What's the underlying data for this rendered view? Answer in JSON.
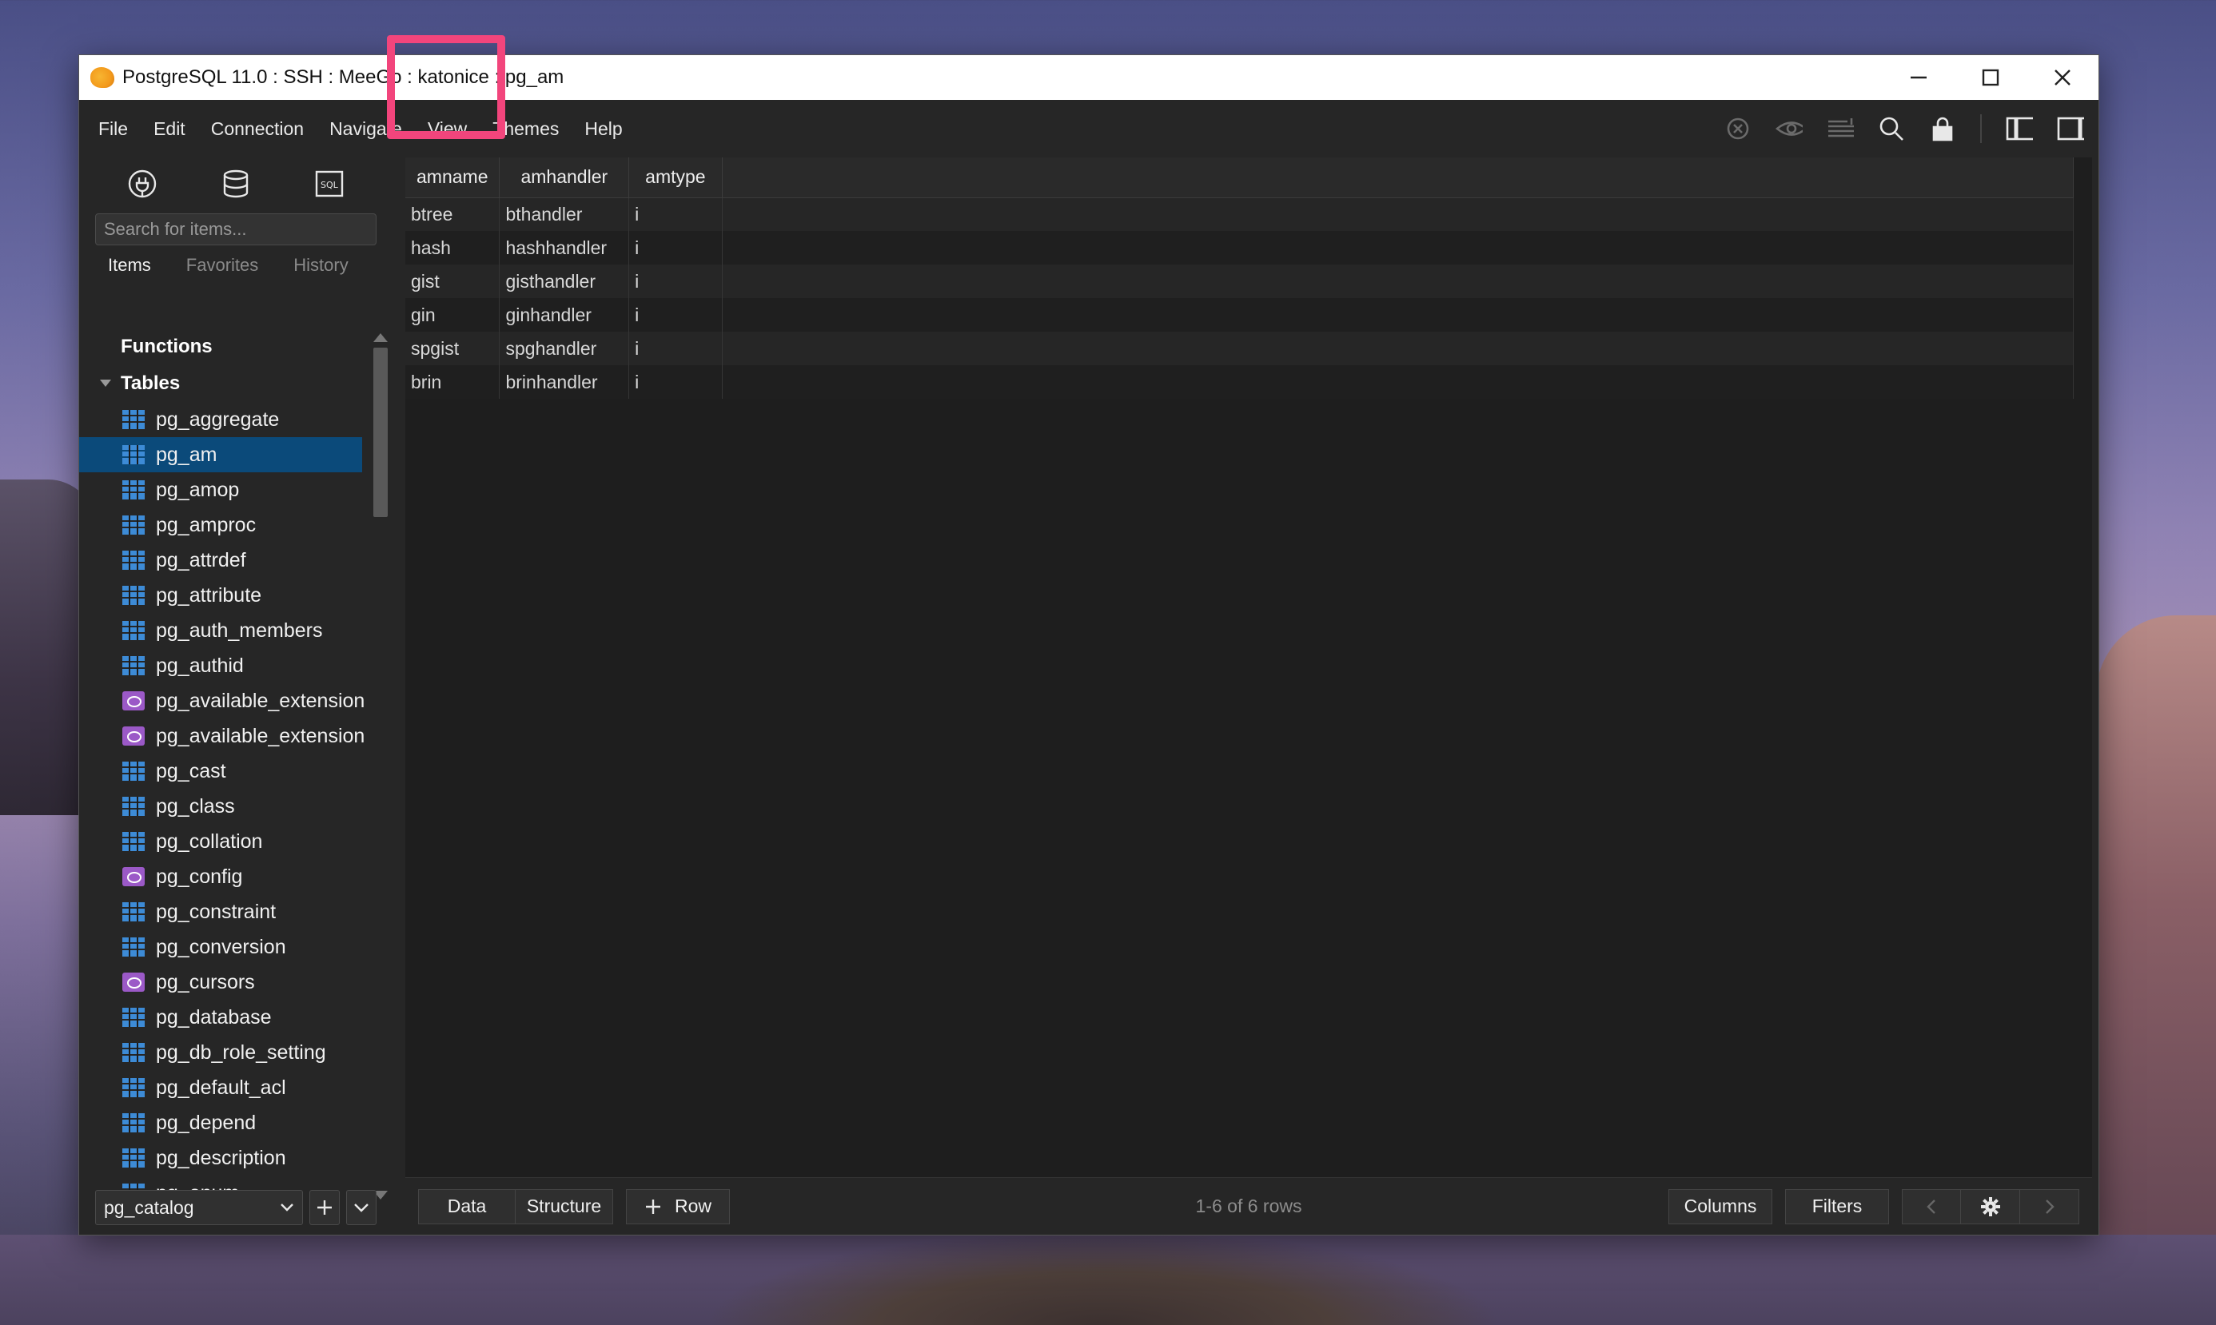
{
  "window": {
    "title": "PostgreSQL 11.0 : SSH : MeeGo : katonice : pg_am"
  },
  "menu": [
    "File",
    "Edit",
    "Connection",
    "Navigate",
    "View",
    "Themes",
    "Help"
  ],
  "toolbar_icons": [
    "close-circle-icon",
    "eye-icon",
    "lines-icon",
    "search-icon",
    "lock-icon",
    "left-panel-icon",
    "right-panel-icon"
  ],
  "sidebar": {
    "search_placeholder": "Search for items...",
    "tabs": [
      "Items",
      "Favorites",
      "History"
    ],
    "active_tab": "Items",
    "groups": {
      "functions": "Functions",
      "tables": "Tables"
    },
    "items": [
      {
        "label": "pg_aggregate",
        "kind": "table"
      },
      {
        "label": "pg_am",
        "kind": "table",
        "selected": true
      },
      {
        "label": "pg_amop",
        "kind": "table"
      },
      {
        "label": "pg_amproc",
        "kind": "table"
      },
      {
        "label": "pg_attrdef",
        "kind": "table"
      },
      {
        "label": "pg_attribute",
        "kind": "table"
      },
      {
        "label": "pg_auth_members",
        "kind": "table"
      },
      {
        "label": "pg_authid",
        "kind": "table"
      },
      {
        "label": "pg_available_extension",
        "kind": "view"
      },
      {
        "label": "pg_available_extension",
        "kind": "view"
      },
      {
        "label": "pg_cast",
        "kind": "table"
      },
      {
        "label": "pg_class",
        "kind": "table"
      },
      {
        "label": "pg_collation",
        "kind": "table"
      },
      {
        "label": "pg_config",
        "kind": "view"
      },
      {
        "label": "pg_constraint",
        "kind": "table"
      },
      {
        "label": "pg_conversion",
        "kind": "table"
      },
      {
        "label": "pg_cursors",
        "kind": "view"
      },
      {
        "label": "pg_database",
        "kind": "table"
      },
      {
        "label": "pg_db_role_setting",
        "kind": "table"
      },
      {
        "label": "pg_default_acl",
        "kind": "table"
      },
      {
        "label": "pg_depend",
        "kind": "table"
      },
      {
        "label": "pg_description",
        "kind": "table"
      },
      {
        "label": "pg_enum",
        "kind": "table"
      }
    ],
    "schema": "pg_catalog"
  },
  "table": {
    "columns": [
      "amname",
      "amhandler",
      "amtype"
    ],
    "rows": [
      [
        "btree",
        "bthandler",
        "i"
      ],
      [
        "hash",
        "hashhandler",
        "i"
      ],
      [
        "gist",
        "gisthandler",
        "i"
      ],
      [
        "gin",
        "ginhandler",
        "i"
      ],
      [
        "spgist",
        "spghandler",
        "i"
      ],
      [
        "brin",
        "brinhandler",
        "i"
      ]
    ]
  },
  "bottom": {
    "data_label": "Data",
    "structure_label": "Structure",
    "row_label": "Row",
    "row_info": "1-6 of 6 rows",
    "columns_label": "Columns",
    "filters_label": "Filters"
  },
  "colors": {
    "selected_row": "#0b4a7a",
    "table_icon": "#3d8bd6",
    "view_icon": "#9b59c7",
    "highlight": "#f2457c"
  }
}
